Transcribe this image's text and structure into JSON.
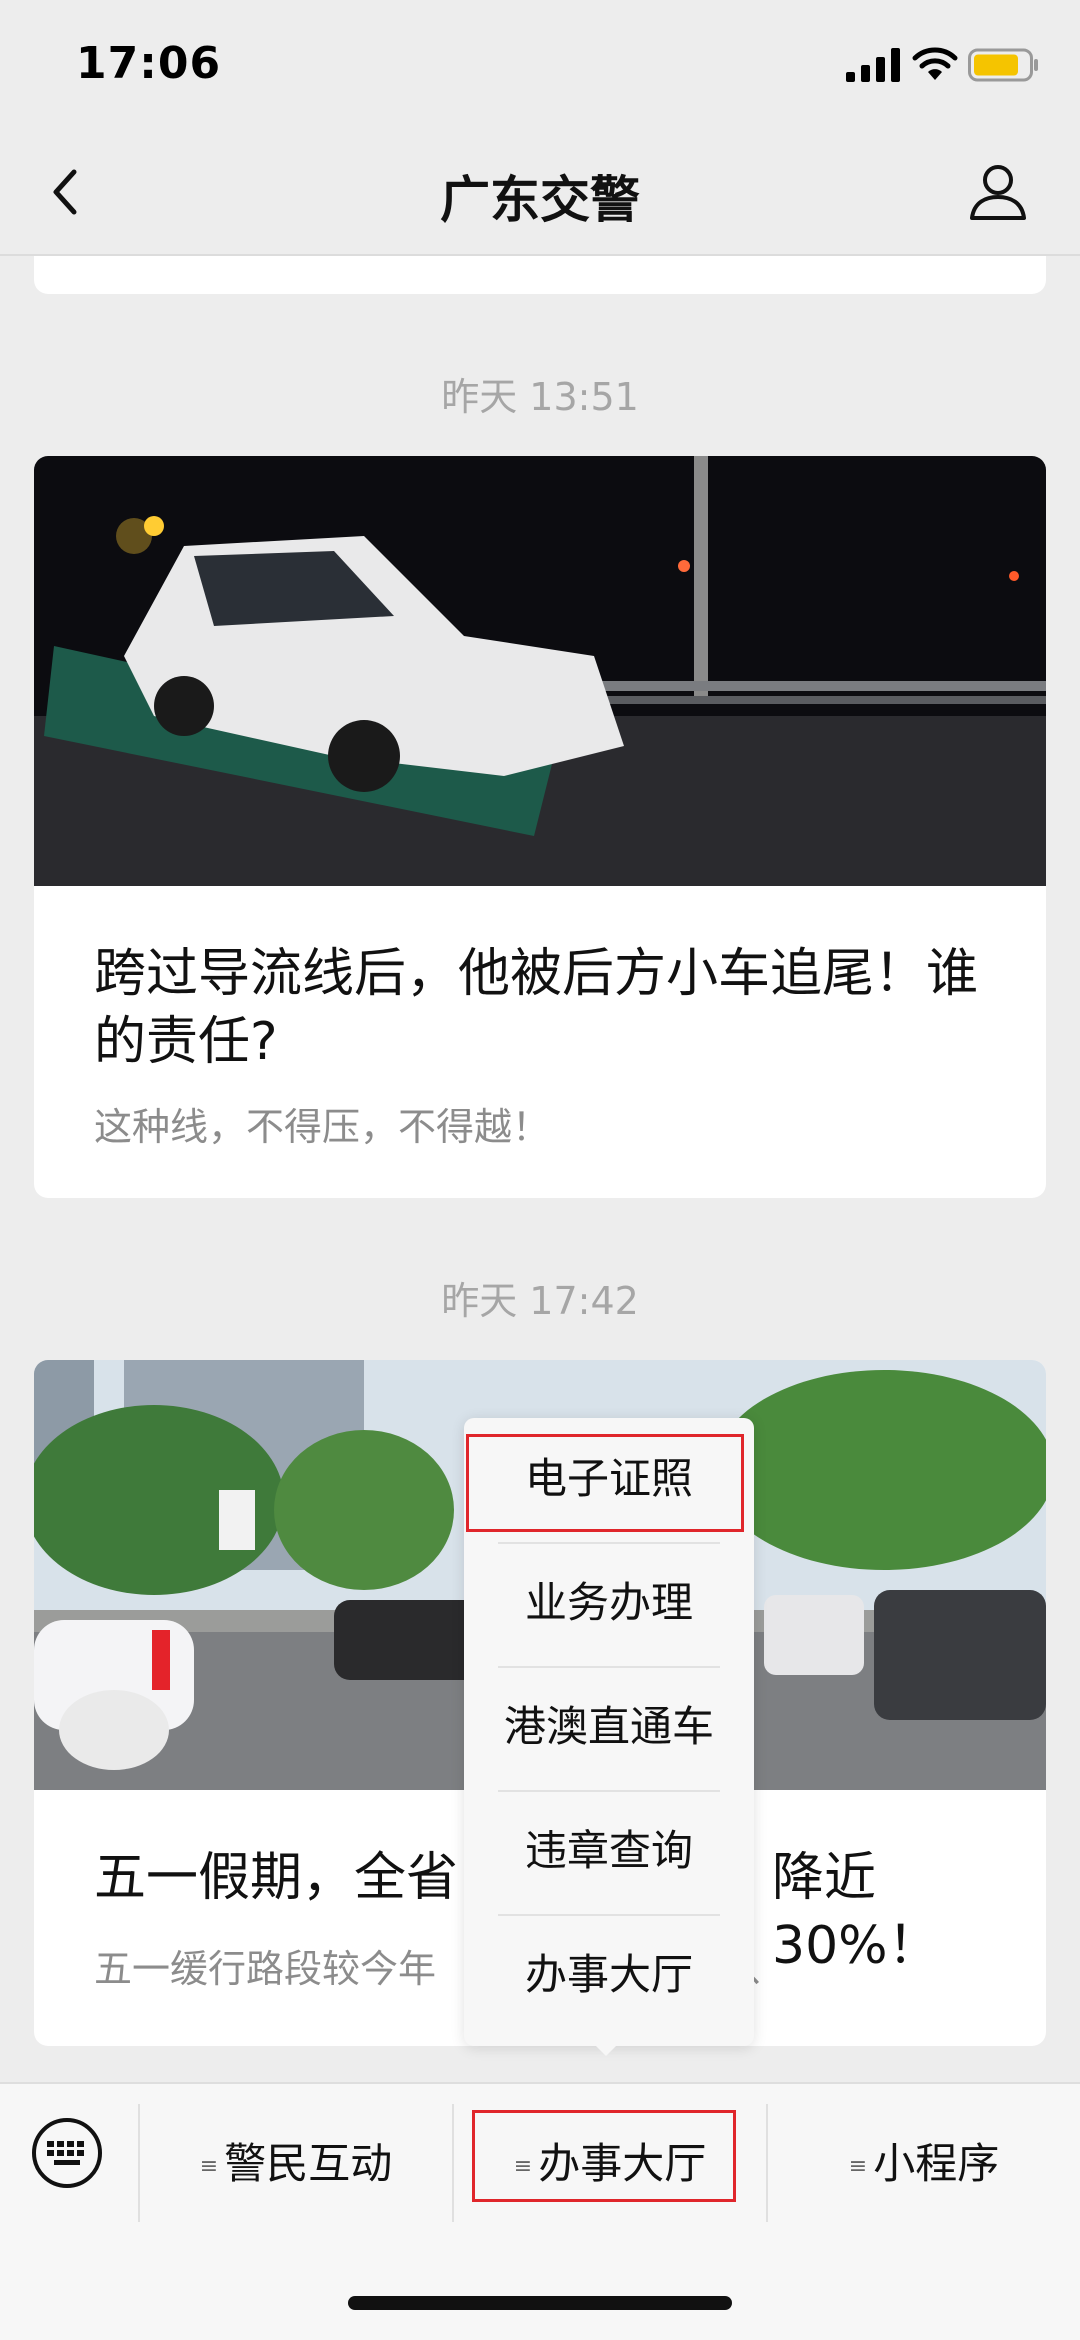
{
  "status_bar": {
    "time": "17:06",
    "battery_color": "#f5c400"
  },
  "nav": {
    "title": "广东交警",
    "back_icon": "chevron-left-icon",
    "profile_icon": "person-icon"
  },
  "feed": [
    {
      "timestamp": "昨天 13:51",
      "title": "跨过导流线后，他被后方小车追尾！谁的责任?",
      "subtitle": "这种线，不得压，不得越！"
    },
    {
      "timestamp": "昨天 17:42",
      "title": "五一假期，全省",
      "title_tail": "降近 30%！",
      "subtitle": "五一缓行路段较今年",
      "subtitle_tail": "、"
    }
  ],
  "popup_menu": {
    "items": [
      "电子证照",
      "业务办理",
      "港澳直通车",
      "违章查询",
      "办事大厅"
    ],
    "highlighted_index": 0
  },
  "bottom_menu": {
    "keyboard_icon": "keyboard-icon",
    "tabs": [
      "警民互动",
      "办事大厅",
      "小程序"
    ],
    "highlighted_index": 1,
    "highlight_color": "#e0262b"
  }
}
